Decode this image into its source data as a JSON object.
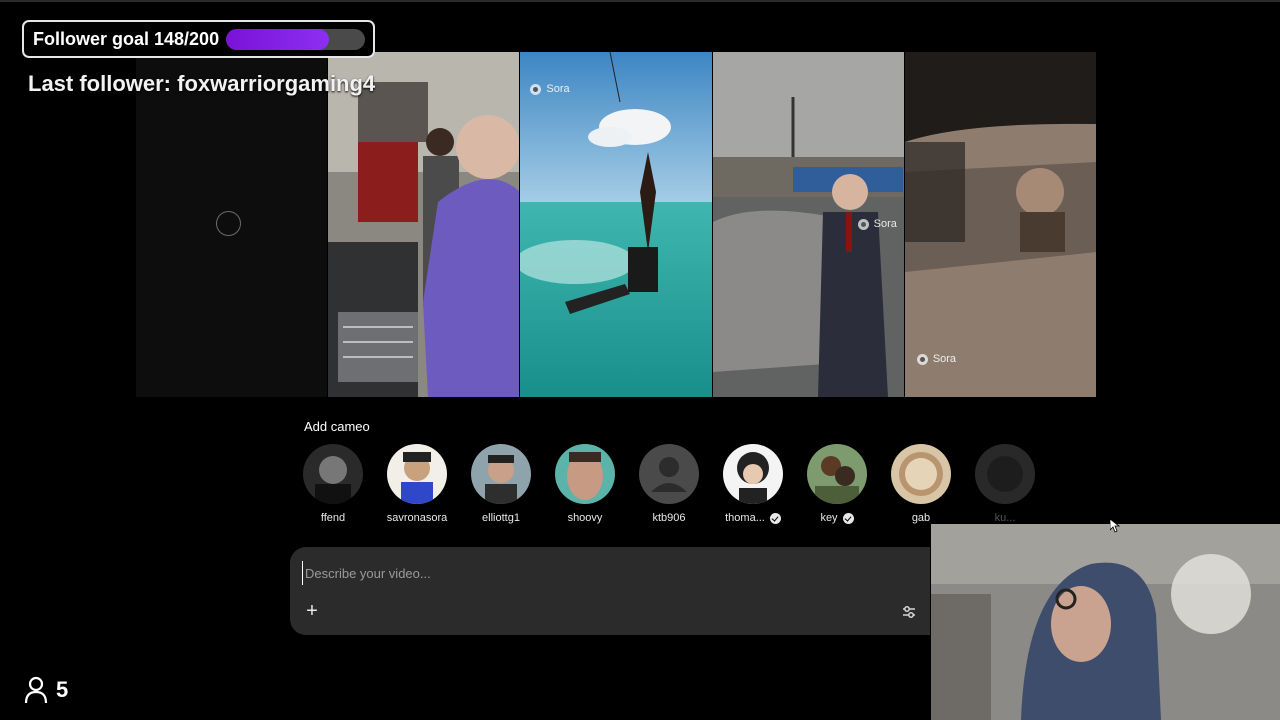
{
  "overlay": {
    "goal_label": "Follower goal 148/200",
    "goal_current": 148,
    "goal_target": 200,
    "goal_color": "#8a2be2",
    "last_follower": "Last follower: foxwarriorgaming4",
    "viewer_count": "5",
    "viewer_icon": "person-icon"
  },
  "videos": [
    {
      "label": "loading",
      "watermark": ""
    },
    {
      "label": "mechanic",
      "watermark": ""
    },
    {
      "label": "kitesurf",
      "watermark": "Sora"
    },
    {
      "label": "suit-car",
      "watermark": "Sora"
    },
    {
      "label": "driver",
      "watermark": "Sora"
    }
  ],
  "cameo_section": {
    "title": "Add cameo",
    "cameos": [
      {
        "name": "ffend",
        "verified": false
      },
      {
        "name": "savronasora",
        "verified": false
      },
      {
        "name": "elliottg1",
        "verified": false
      },
      {
        "name": "shoovy",
        "verified": false
      },
      {
        "name": "ktb906",
        "verified": false
      },
      {
        "name": "thoma...",
        "verified": true
      },
      {
        "name": "key",
        "verified": true
      },
      {
        "name": "gab",
        "verified": false
      },
      {
        "name": "ku...",
        "verified": false
      }
    ]
  },
  "prompt": {
    "placeholder": "Describe your video...",
    "value": "",
    "add_icon": "plus-icon",
    "settings_icon": "sliders-icon"
  },
  "colors": {
    "background": "#000000",
    "prompt_bg": "#2b2b2b"
  }
}
